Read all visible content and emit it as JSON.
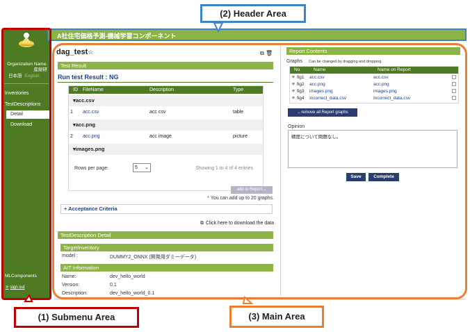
{
  "annotations": {
    "header_area": "(2) Header Area",
    "submenu_area": "(1) Submenu Area",
    "main_area": "(3) Main Area",
    "header_color": "#3f84c9",
    "submenu_color": "#c00000",
    "main_color": "#ed7d31"
  },
  "header": {
    "title": "A社住宅価格予測-機械学習コンポーネント"
  },
  "sidebar": {
    "org_label": "Organization Name:",
    "org_value": "産総研",
    "lang_ja": "日本語",
    "lang_en": "English",
    "items": [
      {
        "label": "Inventories"
      },
      {
        "label": "TestDescriptions"
      }
    ],
    "subitems": [
      {
        "label": "Detail"
      },
      {
        "label": "Download"
      }
    ],
    "ml_components": "MLComponents",
    "sign_out": "sign out"
  },
  "main": {
    "title": "dag_test",
    "star_icon": "star-icon",
    "test_result_band": "Test Result",
    "run_result": "Run test Result : NG",
    "table": {
      "headers": [
        "ID",
        "FileName",
        "Description",
        "Type"
      ],
      "groups": [
        {
          "name": "acc.csv",
          "rows": [
            {
              "id": "1",
              "file": "acc.csv",
              "desc": "acc csv",
              "type": "table"
            }
          ]
        },
        {
          "name": "acc.png",
          "rows": [
            {
              "id": "2",
              "file": "acc.png",
              "desc": "acc image",
              "type": "picture"
            }
          ]
        },
        {
          "name": "images.png",
          "rows": []
        }
      ],
      "rows_per_page_label": "Rows per page:",
      "rows_per_page_value": "5",
      "showing": "Showing 1 to 4 of 4 entries"
    },
    "add_button": "add to Report→",
    "add_note": "* You can add up to 20 graphs.",
    "acceptance": "+ Acceptance Criteria",
    "download": "Click here to download the data",
    "detail_band": "TestDescription Detail",
    "target_inventory_band": "TargetInventory",
    "model_label": "model :",
    "model_value": "DUMMY2_ONNX (開発用ダミーデータ)",
    "ait_band": "AIT Information",
    "ait": [
      {
        "label": "Name:",
        "value": "dev_hello_world"
      },
      {
        "label": "Version:",
        "value": "0.1"
      },
      {
        "label": "Description:",
        "value": "dev_hello_world_0.1"
      }
    ]
  },
  "report": {
    "band": "Report Contents",
    "graphs_label": "Graphs",
    "graphs_note": "Can be changed by dragging and dropping.",
    "headers": [
      "No",
      "Name",
      "Name on Report"
    ],
    "rows": [
      {
        "no": "fig1",
        "name": "acc.csv",
        "report_name": "acc.csv"
      },
      {
        "no": "fig2",
        "name": "acc.png",
        "report_name": "acc.png"
      },
      {
        "no": "fig3",
        "name": "images.png",
        "report_name": "images.png"
      },
      {
        "no": "fig4",
        "name": "Incorrect_data.csv",
        "report_name": "Incorrect_data.csv"
      }
    ],
    "remove_button": "←remove all Report graphs",
    "opinion_label": "Opinion",
    "opinion_text": "精度について問題なし。",
    "save": "Save",
    "complete": "Complete"
  }
}
